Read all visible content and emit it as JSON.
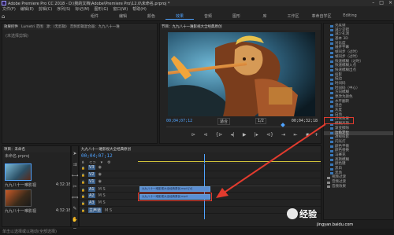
{
  "app": {
    "title": "Adobe Premiere Pro CC 2018 - D:\\我的文档\\Adobe\\Premiere Pro\\12.0\\未命名.prproj *"
  },
  "menu": [
    "文件(F)",
    "编辑(E)",
    "剪辑(C)",
    "序列(S)",
    "标记(M)",
    "图形(G)",
    "窗口(W)",
    "帮助(H)"
  ],
  "workspaces": [
    {
      "label": "组件"
    },
    {
      "label": "编辑"
    },
    {
      "label": "颜色"
    },
    {
      "label": "效果",
      "active": true
    },
    {
      "label": "音频"
    },
    {
      "label": "图形"
    },
    {
      "label": "库"
    },
    {
      "label": "工作区"
    },
    {
      "label": "革命自学区"
    },
    {
      "label": "Editing"
    }
  ],
  "source_panel": {
    "tabs": [
      "效果控件",
      "Lumetri 范围",
      "源：(无剪辑)",
      "音频剪辑混合器：九九八十一难"
    ],
    "message": "(未选择剪辑)"
  },
  "program": {
    "title": "节目：九九八十一难影视大全经典原创",
    "timecode": "00;04;07;12",
    "fit": "适合",
    "quality": "1/2",
    "duration": "00;04;32;18",
    "controls": [
      "mark-in",
      "mark-out",
      "go-to-in",
      "step-back",
      "play",
      "step-forward",
      "go-to-out",
      "insert",
      "overwrite",
      "export-frame",
      "button-editor"
    ]
  },
  "effects": {
    "items": [
      {
        "label": "亮度键"
      },
      {
        "label": "减少交错"
      },
      {
        "label": "减少孔洞"
      },
      {
        "label": "基本 3D"
      },
      {
        "label": "对比度"
      },
      {
        "label": "展开字幕"
      },
      {
        "label": "帧同步（过时）"
      },
      {
        "label": "帧同步（过时）"
      },
      {
        "label": "快速模糊（过时）"
      },
      {
        "label": "快速模糊入点"
      },
      {
        "label": "快速模糊出点"
      },
      {
        "label": "投影"
      },
      {
        "label": "描边"
      },
      {
        "label": "时间码"
      },
      {
        "label": "时间码（中心）"
      },
      {
        "label": "方向模糊"
      },
      {
        "label": "更改为颜色"
      },
      {
        "label": "水平翻转"
      },
      {
        "label": "混合"
      },
      {
        "label": "灰度"
      },
      {
        "label": "白场"
      },
      {
        "label": "灯光效果"
      },
      {
        "label": "模糊高斯"
      },
      {
        "label": "渐变擦除"
      },
      {
        "label": "边角定位",
        "selected": true
      },
      {
        "label": "透视投影"
      },
      {
        "label": "闪光灯"
      },
      {
        "label": "颜色平衡"
      },
      {
        "label": "颜色替换"
      },
      {
        "label": "马赛克"
      },
      {
        "label": "高斯模糊"
      },
      {
        "label": "颜色键"
      },
      {
        "label": "黑白"
      },
      {
        "label": "黑场"
      },
      {
        "label": "视频过渡",
        "folder": true
      },
      {
        "label": "音频过渡",
        "folder": true
      },
      {
        "label": "音频效果",
        "folder": true
      }
    ]
  },
  "project": {
    "title": "项目：未命名",
    "file": "未命名.prproj",
    "clips": [
      {
        "name": "九九八十一难影视",
        "duration": "4:32:18"
      },
      {
        "name": "九九八十一难影视",
        "duration": "4:32:18"
      }
    ],
    "status": "单击以选择或以拖动(全部选择)"
  },
  "timeline": {
    "title": "九九八十一难影视大全经典原创",
    "timecode": "00;04;07;12",
    "tracks": [
      {
        "label": "V3"
      },
      {
        "label": "V2"
      },
      {
        "label": "V1"
      },
      {
        "label": "A1"
      },
      {
        "label": "A2"
      },
      {
        "label": "A3"
      },
      {
        "label": "主声道"
      }
    ],
    "clip_v1": "九九八十一难影视大全经典原创.mp4 [V]",
    "clip_a1": "九九八十一难影视大全经典原创.mp4"
  },
  "watermark": {
    "text": "经验",
    "sub": "jingyan.baidu.com"
  },
  "colors": {
    "accent": "#4fa3ff",
    "highlight": "#e23b2e",
    "clip": "#5b8ed1"
  }
}
